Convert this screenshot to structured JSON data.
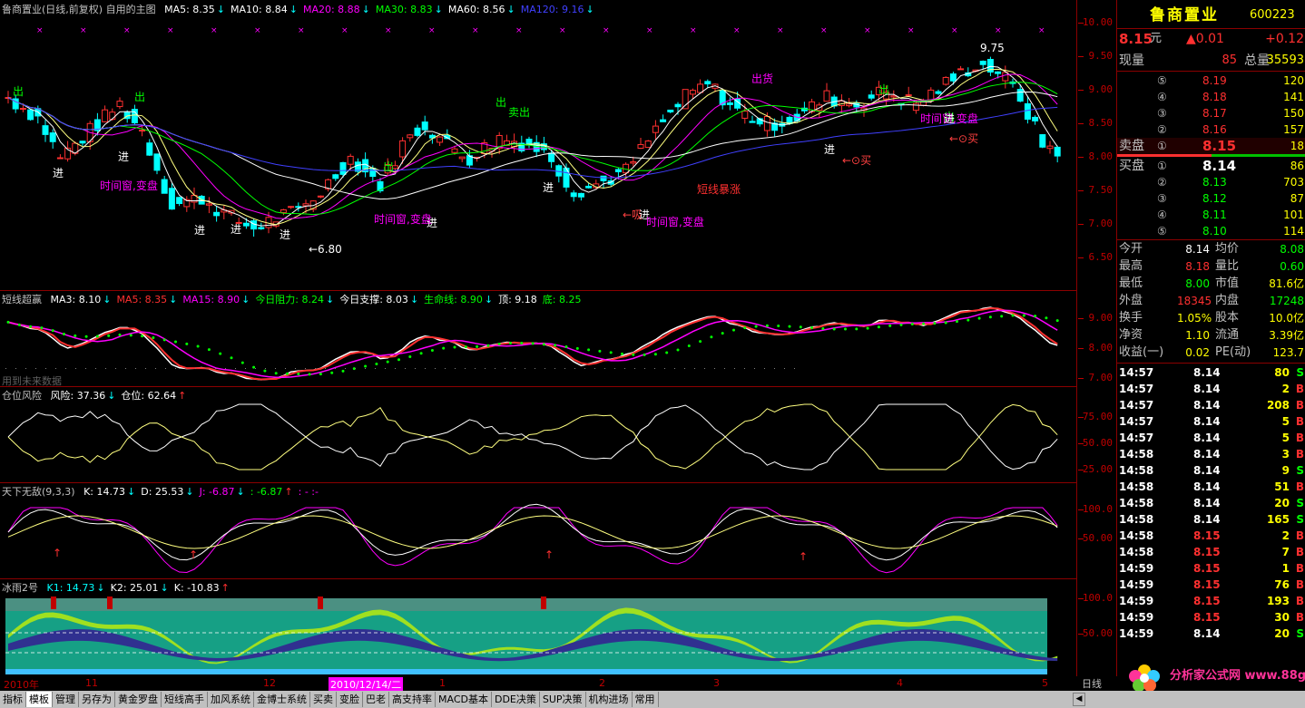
{
  "main_pane": {
    "title": "鲁商置业(日线,前复权) 自用的主图",
    "indicators": [
      {
        "label": "MA5: 8.35",
        "arrow": "↓",
        "color": "#ffffff"
      },
      {
        "label": "MA10: 8.84",
        "arrow": "↓",
        "color": "#ffffff"
      },
      {
        "label": "MA20: 8.88",
        "arrow": "↓",
        "color": "#ff00ff"
      },
      {
        "label": "MA30: 8.83",
        "arrow": "↓",
        "color": "#00ff00"
      },
      {
        "label": "MA60: 8.56",
        "arrow": "↓",
        "color": "#ffffff"
      },
      {
        "label": "MA120: 9.16",
        "arrow": "↓",
        "color": "#4040ff"
      }
    ],
    "annotations": [
      {
        "text": "出",
        "color": "#00ff00"
      },
      {
        "text": "进",
        "color": "#ffffff"
      },
      {
        "text": "时间窗,变盘",
        "color": "#ff00ff"
      },
      {
        "text": "出",
        "color": "#00ff00"
      },
      {
        "text": "进",
        "color": "#ffffff"
      },
      {
        "text": "进",
        "color": "#ffffff"
      },
      {
        "text": "进",
        "color": "#ffffff"
      },
      {
        "text": "进",
        "color": "#ffffff"
      },
      {
        "text": "←6.80",
        "color": "#ffffff"
      },
      {
        "text": "时间窗,变盘",
        "color": "#ff00ff"
      },
      {
        "text": "出",
        "color": "#00ff00"
      },
      {
        "text": "进",
        "color": "#ffffff"
      },
      {
        "text": "出",
        "color": "#00ff00"
      },
      {
        "text": "卖出",
        "color": "#00ff00"
      },
      {
        "text": "进",
        "color": "#ffffff"
      },
      {
        "text": "←吸",
        "color": "#ff4040"
      },
      {
        "text": "进",
        "color": "#ffffff"
      },
      {
        "text": "时间窗,变盘",
        "color": "#ff00ff"
      },
      {
        "text": "短线暴涨",
        "color": "#ff3030"
      },
      {
        "text": "出货",
        "color": "#ff00ff"
      },
      {
        "text": "出",
        "color": "#00ff00"
      },
      {
        "text": "进",
        "color": "#ffffff"
      },
      {
        "text": "←⊙买",
        "color": "#ff4040"
      },
      {
        "text": "出",
        "color": "#00ff00"
      },
      {
        "text": "时间窗,变盘",
        "color": "#ff00ff"
      },
      {
        "text": "进",
        "color": "#ffffff"
      },
      {
        "text": "←⊙买",
        "color": "#ff4040"
      },
      {
        "text": "9.75",
        "color": "#ffffff"
      }
    ],
    "axis_ticks": [
      "10.00",
      "9.50",
      "9.00",
      "8.50",
      "8.00",
      "7.50",
      "7.00",
      "6.50"
    ]
  },
  "pane2": {
    "title": "短线超赢",
    "items": [
      {
        "label": "MA3: 8.10",
        "arrow": "↓",
        "color": "#ffffff"
      },
      {
        "label": "MA5: 8.35",
        "arrow": "↓",
        "color": "#ff3030"
      },
      {
        "label": "MA15: 8.90",
        "arrow": "↓",
        "color": "#ff00ff"
      },
      {
        "label": "今日阻力: 8.24",
        "arrow": "↓",
        "color": "#00ff00"
      },
      {
        "label": "今日支撑: 8.03",
        "arrow": "↓",
        "color": "#ffffff"
      },
      {
        "label": "生命线: 8.90",
        "arrow": "↓",
        "color": "#00ff00"
      },
      {
        "label": "顶: 9.18",
        "arrow": "",
        "color": "#ffffff"
      },
      {
        "label": "底: 8.25",
        "arrow": "",
        "color": "#00ff00"
      }
    ],
    "note": "用到未来数据",
    "axis_ticks": [
      "9.00",
      "8.00",
      "7.00"
    ]
  },
  "pane3": {
    "title": "仓位风险",
    "items": [
      {
        "label": "风险: 37.36",
        "arrow": "↓",
        "color": "#ffffff"
      },
      {
        "label": "仓位: 62.64",
        "arrow": "↑",
        "color": "#ffffff"
      }
    ],
    "axis_ticks": [
      "75.00",
      "50.00",
      "25.00"
    ]
  },
  "pane4": {
    "title": "天下无敌(9,3,3)",
    "items": [
      {
        "label": "K: 14.73",
        "arrow": "↓",
        "color": "#ffffff"
      },
      {
        "label": "D: 25.53",
        "arrow": "↓",
        "color": "#ffffff"
      },
      {
        "label": "J: -6.87",
        "arrow": "↓",
        "color": "#ff00ff"
      },
      {
        "label": ": -6.87",
        "arrow": "↑",
        "color": "#00ff00"
      },
      {
        "label": ": - :-",
        "arrow": "",
        "color": "#ff00ff"
      }
    ],
    "axis_ticks": [
      "100.0",
      "50.00"
    ]
  },
  "pane5": {
    "title": "冰雨2号",
    "items": [
      {
        "label": "K1: 14.73",
        "arrow": "↓",
        "color": "#00ffff"
      },
      {
        "label": "K2: 25.01",
        "arrow": "↓",
        "color": "#ffffff"
      },
      {
        "label": "K: -10.83",
        "arrow": "↑",
        "color": "#ffffff"
      }
    ],
    "axis_ticks": [
      "100.0",
      "50.00"
    ]
  },
  "date_axis": [
    "2010年",
    "11",
    "12",
    "2010/12/14/二",
    "1",
    "2",
    "3",
    "4",
    "5"
  ],
  "right_panel": {
    "stock_name": "鲁商置业",
    "stock_code": "600223",
    "price": "8.15",
    "price_unit": "元",
    "change": "▲0.01",
    "change_pct": "+0.12",
    "xianliang_label": "现量",
    "xianliang": "85",
    "zongliang_label": "总量",
    "zongliang": "35593",
    "sell_label": "卖盘",
    "buy_label": "买盘",
    "sells": [
      {
        "idx": "⑤",
        "price": "8.19",
        "vol": "120"
      },
      {
        "idx": "④",
        "price": "8.18",
        "vol": "141"
      },
      {
        "idx": "③",
        "price": "8.17",
        "vol": "150"
      },
      {
        "idx": "②",
        "price": "8.16",
        "vol": "157"
      },
      {
        "idx": "①",
        "price": "8.15",
        "vol": "18"
      }
    ],
    "buys": [
      {
        "idx": "①",
        "price": "8.14",
        "vol": "86"
      },
      {
        "idx": "②",
        "price": "8.13",
        "vol": "703"
      },
      {
        "idx": "③",
        "price": "8.12",
        "vol": "87"
      },
      {
        "idx": "④",
        "price": "8.11",
        "vol": "101"
      },
      {
        "idx": "⑤",
        "price": "8.10",
        "vol": "114"
      }
    ],
    "stats": [
      {
        "l1": "今开",
        "v1": "8.14",
        "c1": "#ffffff",
        "l2": "均价",
        "v2": "8.08",
        "c2": "#00ff00"
      },
      {
        "l1": "最高",
        "v1": "8.18",
        "c1": "#ff3030",
        "l2": "量比",
        "v2": "0.60",
        "c2": "#00ff00"
      },
      {
        "l1": "最低",
        "v1": "8.00",
        "c1": "#00ff00",
        "l2": "市值",
        "v2": "81.6亿",
        "c2": "#ffff00"
      },
      {
        "l1": "外盘",
        "v1": "18345",
        "c1": "#ff3030",
        "l2": "内盘",
        "v2": "17248",
        "c2": "#00ff00"
      },
      {
        "l1": "换手",
        "v1": "1.05%",
        "c1": "#ffff00",
        "l2": "股本",
        "v2": "10.0亿",
        "c2": "#ffff00"
      },
      {
        "l1": "净资",
        "v1": "1.10",
        "c1": "#ffff00",
        "l2": "流通",
        "v2": "3.39亿",
        "c2": "#ffff00"
      },
      {
        "l1": "收益(一)",
        "v1": "0.02",
        "c1": "#ffff00",
        "l2": "PE(动)",
        "v2": "123.7",
        "c2": "#ffff00"
      }
    ],
    "ticks": [
      {
        "time": "14:57",
        "price": "8.14",
        "vol": "80",
        "side": "S"
      },
      {
        "time": "14:57",
        "price": "8.14",
        "vol": "2",
        "side": "B"
      },
      {
        "time": "14:57",
        "price": "8.14",
        "vol": "208",
        "side": "B"
      },
      {
        "time": "14:57",
        "price": "8.14",
        "vol": "5",
        "side": "B"
      },
      {
        "time": "14:57",
        "price": "8.14",
        "vol": "5",
        "side": "B"
      },
      {
        "time": "14:58",
        "price": "8.14",
        "vol": "3",
        "side": "B"
      },
      {
        "time": "14:58",
        "price": "8.14",
        "vol": "9",
        "side": "S"
      },
      {
        "time": "14:58",
        "price": "8.14",
        "vol": "51",
        "side": "B"
      },
      {
        "time": "14:58",
        "price": "8.14",
        "vol": "20",
        "side": "S"
      },
      {
        "time": "14:58",
        "price": "8.14",
        "vol": "165",
        "side": "S"
      },
      {
        "time": "14:58",
        "price": "8.15",
        "vol": "2",
        "side": "B"
      },
      {
        "time": "14:58",
        "price": "8.15",
        "vol": "7",
        "side": "B"
      },
      {
        "time": "14:59",
        "price": "8.15",
        "vol": "1",
        "side": "B"
      },
      {
        "time": "14:59",
        "price": "8.15",
        "vol": "76",
        "side": "B"
      },
      {
        "time": "14:59",
        "price": "8.15",
        "vol": "193",
        "side": "B"
      },
      {
        "time": "14:59",
        "price": "8.15",
        "vol": "30",
        "side": "B"
      },
      {
        "time": "14:59",
        "price": "8.14",
        "vol": "20",
        "side": "S"
      }
    ]
  },
  "bottom_tabs": [
    "指标",
    "模板",
    "管理",
    "另存为",
    "黄金罗盘",
    "短线高手",
    "加风系统",
    "金博士系统",
    "买卖",
    "变脸",
    "巴老",
    "高支持率",
    "MACD基本",
    "DDE决策",
    "SUP决策",
    "机构进场",
    "常用"
  ],
  "active_tab_index": 1,
  "period_label": "日线",
  "watermark": "分析家公式网 www.88gs.com"
}
